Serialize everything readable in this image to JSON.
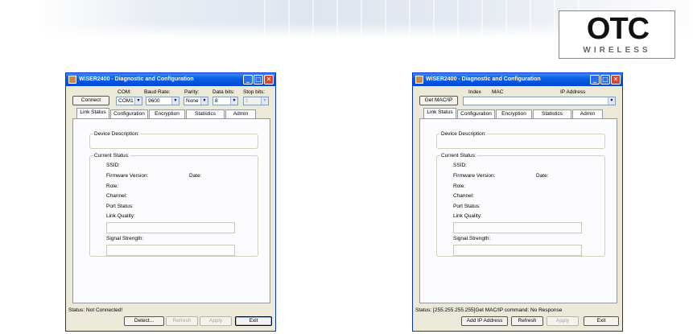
{
  "logo": {
    "mark": "OTC",
    "sub": "WIRELESS"
  },
  "windows": [
    {
      "title": "WiSER2400 - Diagnostic and Configuration",
      "connect_label": "Connect",
      "labels": {
        "com": "COM:",
        "baud": "Baud Rate:",
        "parity": "Parity:",
        "databits": "Data bits:",
        "stopbits": "Stop bits:"
      },
      "values": {
        "com": "COM1",
        "baud": "9600",
        "parity": "None",
        "databits": "8",
        "stopbits": "1"
      },
      "tabs": [
        "Link Status",
        "Configuration",
        "Encryption",
        "Statistics",
        "Admin"
      ],
      "device_description": "Device Description:",
      "current_status": "Current Status:",
      "fields": {
        "ssid": "SSID:",
        "firmware": "Firmware Version:",
        "date": "Date:",
        "role": "Role:",
        "channel": "Channel:",
        "port_status": "Port Status:",
        "link_quality": "Link Quality:",
        "signal_strength": "Signal Strength:"
      },
      "status_text": "Status: Not Connected!",
      "buttons": {
        "detect": "Detect...",
        "refresh": "Refresh",
        "apply": "Apply",
        "exit": "Exit"
      }
    },
    {
      "title": "WiSER2400 - Diagnostic and Configuration",
      "get_mac_label": "Get MAC/IP",
      "columns": {
        "index": "Index",
        "mac": "MAC",
        "ip": "IP Address"
      },
      "tabs": [
        "Link Status",
        "Configuration",
        "Encryption",
        "Statistics",
        "Admin"
      ],
      "device_description": "Device Description:",
      "current_status": "Current Status:",
      "fields": {
        "ssid": "SSID:",
        "firmware": "Firmware Version:",
        "date": "Date:",
        "role": "Role:",
        "channel": "Channel:",
        "port_status": "Port Status:",
        "link_quality": "Link Quality:",
        "signal_strength": "Signal Strength:"
      },
      "status_text": "Status: [255.255.255.255]Get MAC/IP command: No Response",
      "buttons": {
        "add_ip": "Add IP Address",
        "refresh": "Refresh",
        "apply": "Apply",
        "exit": "Exit"
      }
    }
  ]
}
